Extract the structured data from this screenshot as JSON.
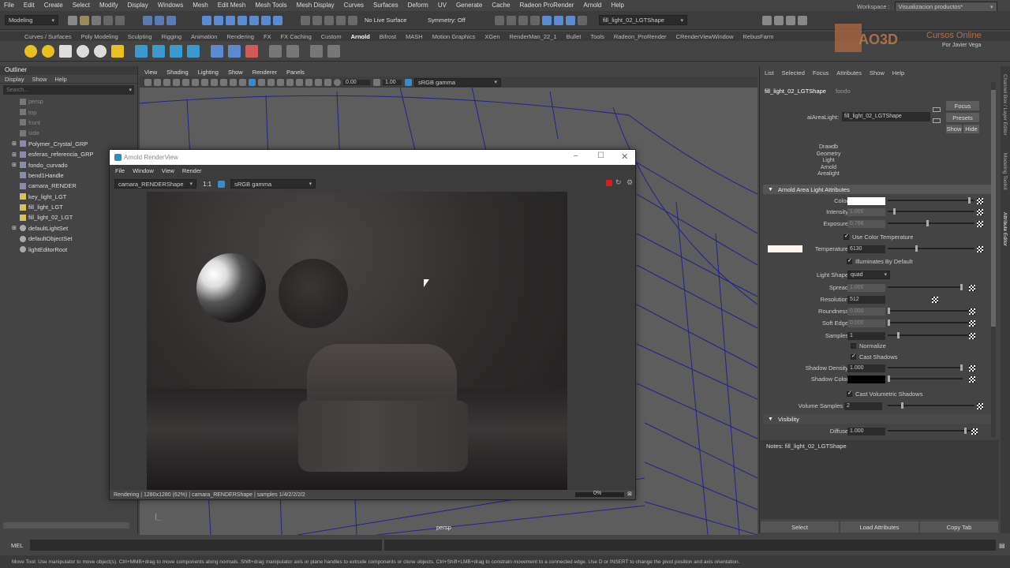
{
  "menubar": [
    "File",
    "Edit",
    "Create",
    "Select",
    "Modify",
    "Display",
    "Windows",
    "Mesh",
    "Edit Mesh",
    "Mesh Tools",
    "Mesh Display",
    "Curves",
    "Surfaces",
    "Deform",
    "UV",
    "Generate",
    "Cache",
    "Radeon ProRender",
    "Arnold",
    "Help"
  ],
  "workspace": {
    "label": "Workspace :",
    "value": "Visualizacion productos*"
  },
  "status": {
    "mode": "Modeling",
    "live_surface": "No Live Surface",
    "symmetry": "Symmetry: Off",
    "object_field": "fill_light_02_LGTShape"
  },
  "shelf_tabs": [
    "Curves / Surfaces",
    "Poly Modeling",
    "Sculpting",
    "Rigging",
    "Animation",
    "Rendering",
    "FX",
    "FX Caching",
    "Custom",
    "Arnold",
    "Bifrost",
    "MASH",
    "Motion Graphics",
    "XGen",
    "RenderMan_22_1",
    "Bullet",
    "Tools",
    "Radeon_ProRender",
    "CRenderViewWindow",
    "RebusFarm"
  ],
  "active_shelf": "Arnold",
  "watermark": {
    "logo": "AO3D",
    "title": "Cursos Online",
    "subtitle": "Por Javier Vega"
  },
  "outliner": {
    "title": "Outliner",
    "menu": [
      "Display",
      "Show",
      "Help"
    ],
    "search_placeholder": "Search...",
    "items": [
      {
        "label": "persp",
        "dim": true
      },
      {
        "label": "top",
        "dim": true
      },
      {
        "label": "front",
        "dim": true
      },
      {
        "label": "side",
        "dim": true
      },
      {
        "label": "Polymer_Crystal_GRP",
        "dim": false
      },
      {
        "label": "esferas_referencia_GRP",
        "dim": false
      },
      {
        "label": "fondo_curvado",
        "dim": false
      },
      {
        "label": "bend1Handle",
        "dim": false
      },
      {
        "label": "camara_RENDER",
        "dim": false
      },
      {
        "label": "key_light_LGT",
        "dim": false
      },
      {
        "label": "fill_light_LGT",
        "dim": false
      },
      {
        "label": "fill_light_02_LGT",
        "dim": false
      },
      {
        "label": "defaultLightSet",
        "dim": false
      },
      {
        "label": "defaultObjectSet",
        "dim": false
      },
      {
        "label": "lightEditorRoot",
        "dim": false
      }
    ]
  },
  "viewport": {
    "menu": [
      "View",
      "Shading",
      "Lighting",
      "Show",
      "Renderer",
      "Panels"
    ],
    "exposure": "0.00",
    "gamma": "1.00",
    "colorspace": "sRGB gamma",
    "camera_label": "persp"
  },
  "renderview": {
    "title": "Arnold RenderView",
    "menu": [
      "File",
      "Window",
      "View",
      "Render"
    ],
    "camera": "camara_RENDERShape",
    "ratio": "1:1",
    "colorspace": "sRGB gamma",
    "status": "Rendering | 1280x1280 (62%) | camara_RENDERShape | samples 1/4/2/2/2/2",
    "progress": "0%"
  },
  "attr": {
    "menu": [
      "List",
      "Selected",
      "Focus",
      "Attributes",
      "Show",
      "Help"
    ],
    "tabs": [
      "fill_light_02_LGTShape",
      "fondo"
    ],
    "node_label": "aiAreaLight:",
    "node_value": "fill_light_02_LGTShape",
    "buttons": {
      "focus": "Focus",
      "presets": "Presets",
      "show": "Show",
      "hide": "Hide"
    },
    "classes": [
      "Drawdb",
      "Geometry",
      "Light",
      "Arnold",
      "Arealight"
    ],
    "section": "Arnold Area Light Attributes",
    "color_label": "Color",
    "intensity": {
      "label": "Intensity",
      "value": "1.000"
    },
    "exposure": {
      "label": "Exposure",
      "value": "0.766"
    },
    "use_temp": "Use Color Temperature",
    "temperature": {
      "label": "Temperature",
      "value": "6130"
    },
    "illum_default": "Illuminates By Default",
    "light_shape": {
      "label": "Light Shape",
      "value": "quad"
    },
    "spread": {
      "label": "Spread",
      "value": "1.000"
    },
    "resolution": {
      "label": "Resolution",
      "value": "512"
    },
    "roundness": {
      "label": "Roundness",
      "value": "0.000"
    },
    "soft_edge": {
      "label": "Soft Edge",
      "value": "0.000"
    },
    "samples": {
      "label": "Samples",
      "value": "1"
    },
    "normalize": "Normalize",
    "cast_shadows": "Cast Shadows",
    "shadow_density": {
      "label": "Shadow Density",
      "value": "1.000"
    },
    "shadow_color": {
      "label": "Shadow Color"
    },
    "cast_vol": "Cast Volumetric Shadows",
    "vol_samples": {
      "label": "Volume Samples",
      "value": "2"
    },
    "visibility": "Visibility",
    "diffuse": {
      "label": "Diffuse",
      "value": "1.000"
    },
    "notes": "Notes:  fill_light_02_LGTShape",
    "bottom": [
      "Select",
      "Load Attributes",
      "Copy Tab"
    ]
  },
  "side_tabs": [
    "Channel Box / Layer Editor",
    "Modeling Toolkit",
    "Attribute Editor"
  ],
  "cmd": {
    "label": "MEL"
  },
  "help_text": "Move Tool: Use manipulator to move object(s). Ctrl+MMB+drag to move components along normals. Shift+drag manipulator axis or plane handles to extrude components or clone objects. Ctrl+Shift+LMB+drag to constrain movement to a connected edge. Use D or INSERT to change the pivot position and axis orientation."
}
